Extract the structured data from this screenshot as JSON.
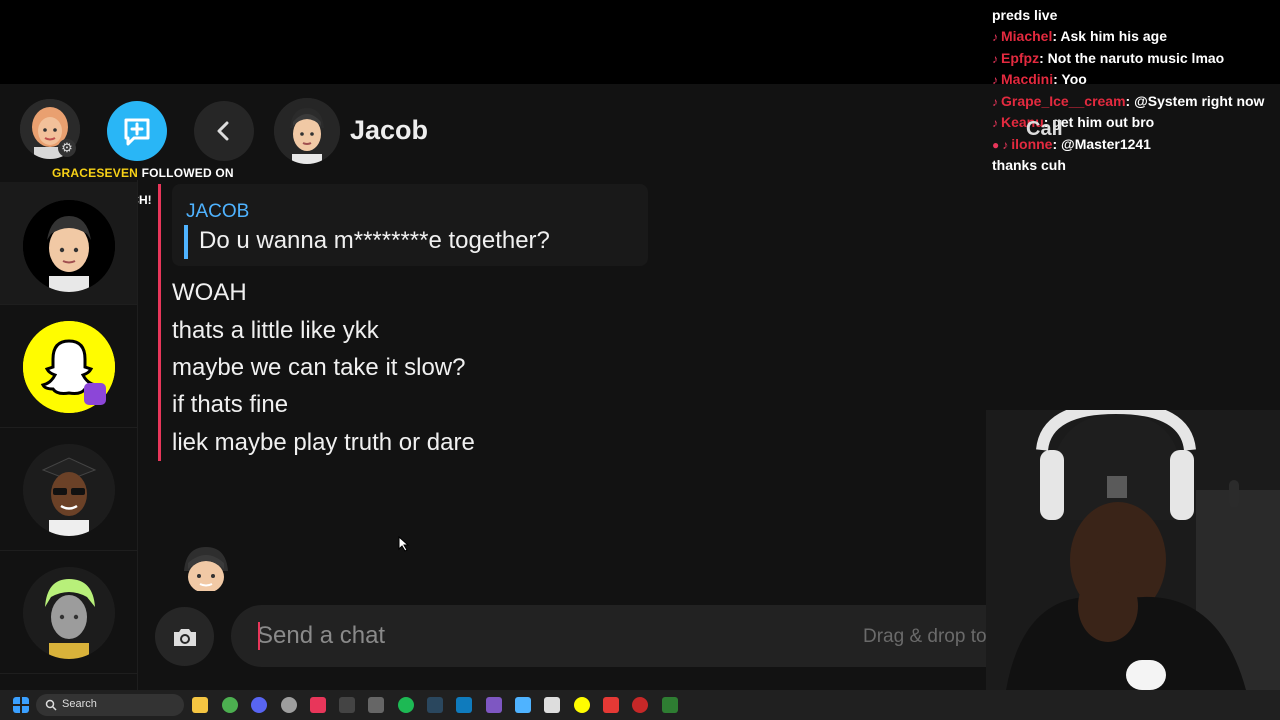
{
  "header": {
    "contact_name": "Jacob",
    "call_label": "Call"
  },
  "alert": {
    "username": "GRACESEVEN",
    "text": "FOLLOWED ON",
    "platform": "TWITCH!"
  },
  "quote": {
    "sender": "JACOB",
    "text": "Do u wanna m********e together?"
  },
  "messages": [
    "WOAH",
    "thats a little like ykk",
    "maybe we can take it slow?",
    "if thats fine",
    "liek maybe play truth or dare"
  ],
  "composer": {
    "placeholder": "Send a chat",
    "drag_hint": "Drag & drop to"
  },
  "stream_chat": [
    {
      "user": "",
      "text": "preds live"
    },
    {
      "user": "Miachel",
      "text": ": Ask him his age"
    },
    {
      "user": "Epfpz",
      "text": ": Not the naruto music lmao"
    },
    {
      "user": "Macdini",
      "text": ": Yoo"
    },
    {
      "user": "Grape_Ice__cream",
      "text": ": @System right now"
    },
    {
      "user": "Keanu",
      "text": ": get him out bro"
    },
    {
      "user": "ilonne",
      "text": ": @Master1241"
    },
    {
      "user": "",
      "text": "thanks cuh"
    }
  ],
  "taskbar": {
    "search_label": "Search"
  },
  "colors": {
    "accent_blue": "#29b6f6",
    "quote_blue": "#4fb3ff",
    "message_bar": "#e8365a",
    "snap_yellow": "#fffc00",
    "alert_yellow": "#f7d117"
  }
}
